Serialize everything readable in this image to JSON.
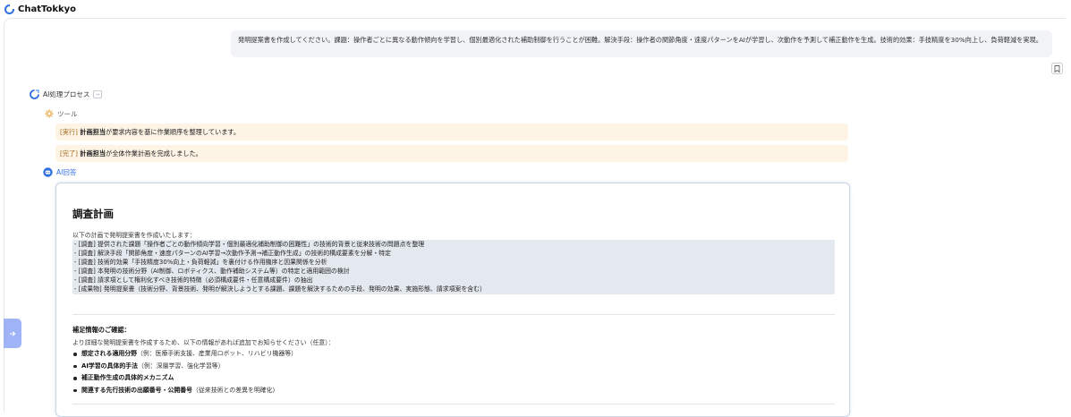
{
  "app": {
    "title": "ChatTokkyo",
    "brand_color": "#2f6fe0"
  },
  "user_message": "発明提案書を作成してください。課題：操作者ごとに異なる動作傾向を学習し、個別最適化された補助制御を行うことが困難。解決手段：操作者の関節角度・速度パターンをAIが学習し、次動作を予測して補正動作を生成。技術的効果：手技精度を30%向上し、負荷軽減を実現。",
  "process": {
    "label": "AI処理プロセス",
    "collapse_symbol": "−"
  },
  "tool": {
    "label": "ツール",
    "logs": [
      {
        "tag": "[実行]",
        "actor": "計画担当",
        "text": "が要求内容を基に作業順序を整理しています。"
      },
      {
        "tag": "[完了]",
        "actor": "計画担当",
        "text": "が全体作業計画を完成しました。"
      }
    ]
  },
  "answer": {
    "label": "AI回答",
    "heading": "調査計画",
    "intro": "以下の計画で発明提案書を作成いたします：",
    "plan_lines": [
      "- [調査] 提供された課題「操作者ごとの動作傾向学習・個別最適化補助制御の困難性」の技術的背景と従来技術の問題点を整理",
      "- [調査] 解決手段「関節角度・速度パターンのAI学習→次動作予測→補正動作生成」の技術的構成要素を分解・特定",
      "- [調査] 技術的効果「手技精度30%向上・負荷軽減」を裏付ける作用機序と因果関係を分析",
      "- [調査] 本発明の技術分野（AI制御、ロボティクス、動作補助システム等）の特定と適用範囲の検討",
      "- [調査] 請求項として権利化すべき技術的特徴（必須構成要件・任意構成要件）の抽出",
      "- [成果物] 発明提案書（技術分野、背景技術、発明が解決しようとする課題、課題を解決するための手段、発明の効果、実施形態、請求項案を含む）"
    ],
    "supplement": {
      "title": "補足情報のご確認：",
      "desc": "より詳細な発明提案書を作成するため、以下の情報があれば追加でお知らせください（任意）：",
      "items": [
        {
          "strong": "想定される適用分野",
          "rest": "（例：医療手術支援、産業用ロボット、リハビリ機器等）"
        },
        {
          "strong": "AI学習の具体的手法",
          "rest": "（例：深層学習、強化学習等）"
        },
        {
          "strong": "補正動作生成の具体的メカニズム",
          "rest": ""
        },
        {
          "strong": "関連する先行技術の出願番号・公開番号",
          "rest": "（従来技術との差異を明確化）"
        }
      ]
    }
  },
  "icons": {
    "logo": "chattokkyo-logo-icon",
    "bookmark": "bookmark-icon",
    "process": "ai-process-icon",
    "tool": "gear-icon",
    "answer": "robot-icon",
    "side_tab": "arrow-right-icon"
  }
}
